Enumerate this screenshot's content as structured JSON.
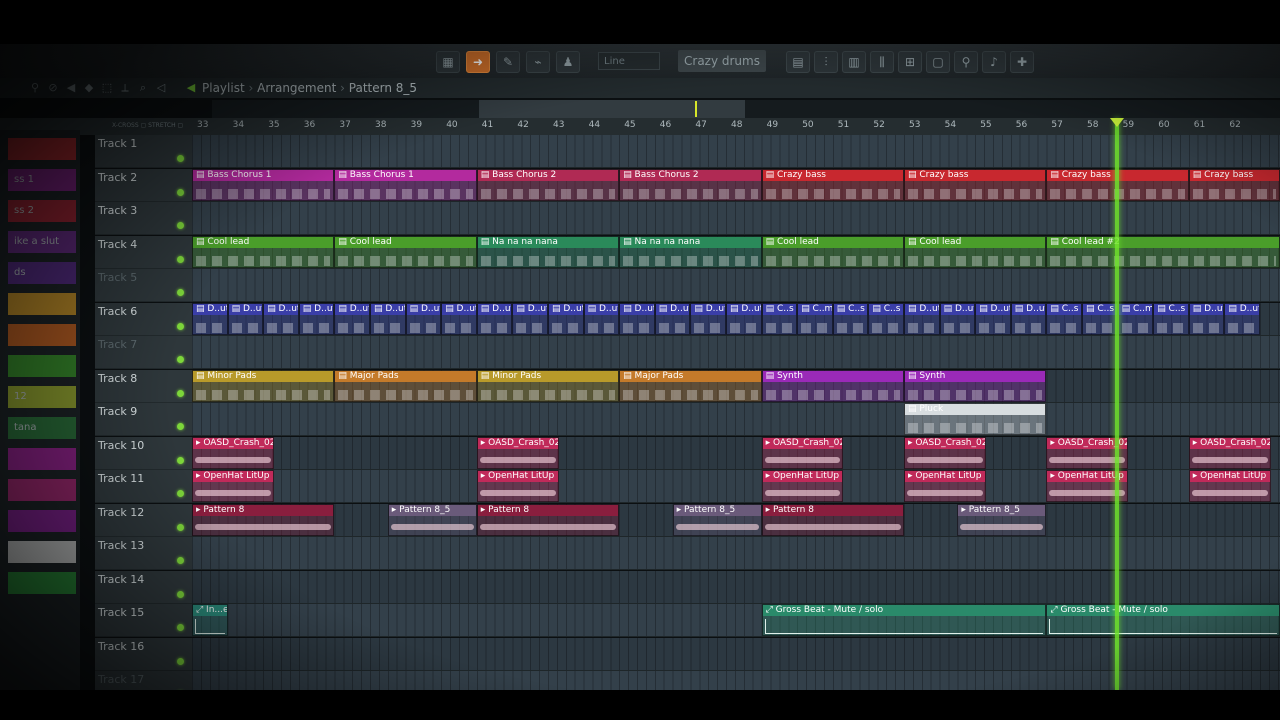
{
  "window": {
    "title_parts": [
      "Playlist",
      "Arrangement",
      "Pattern 8_5"
    ],
    "snap_value": "Line",
    "current_pattern": "Crazy drums"
  },
  "ruler": {
    "xcross_label": "X-CROSS",
    "stretch_label": "STRETCH",
    "bars": [
      "33",
      "34",
      "35",
      "36",
      "37",
      "38",
      "39",
      "40",
      "41",
      "42",
      "43",
      "44",
      "45",
      "46",
      "47",
      "48",
      "49",
      "50",
      "51",
      "52",
      "53",
      "54",
      "55",
      "56",
      "57",
      "58",
      "59",
      "60",
      "61",
      "62"
    ]
  },
  "channel_strip": [
    {
      "label": "",
      "color": "#c0282f"
    },
    {
      "label": "ss 1",
      "color": "#8a1f8e"
    },
    {
      "label": "ss 2",
      "color": "#b02233"
    },
    {
      "label": "ike a slut",
      "color": "#6d2a8e"
    },
    {
      "label": "ds",
      "color": "#5b2a8e"
    },
    {
      "label": "",
      "color": "#d49a25"
    },
    {
      "label": "",
      "color": "#d0641f"
    },
    {
      "label": "",
      "color": "#3a9a2a"
    },
    {
      "label": "12",
      "color": "#a2b52e"
    },
    {
      "label": "tana",
      "color": "#2b7a3a"
    },
    {
      "label": "",
      "color": "#a21f9a"
    },
    {
      "label": "",
      "color": "#b0267a"
    },
    {
      "label": "",
      "color": "#8e1e9e"
    },
    {
      "label": "",
      "color": "#dcdcdc"
    },
    {
      "label": "",
      "color": "#2a9a3a"
    }
  ],
  "tracks": [
    {
      "name": "Track 1",
      "dim": false,
      "clips": []
    },
    {
      "name": "Track 2",
      "dim": false,
      "clips": [
        {
          "label": "Bass Chorus 1",
          "bar": 33,
          "len": 4,
          "color": "#b32a9e",
          "kind": "notes"
        },
        {
          "label": "Bass Chorus 1",
          "bar": 37,
          "len": 4,
          "color": "#b32a9e",
          "kind": "notes"
        },
        {
          "label": "Bass Chorus 2",
          "bar": 41,
          "len": 4,
          "color": "#b02a54",
          "kind": "notes"
        },
        {
          "label": "Bass Chorus 2",
          "bar": 45,
          "len": 4,
          "color": "#b02a54",
          "kind": "notes"
        },
        {
          "label": "Crazy bass",
          "bar": 49,
          "len": 4,
          "color": "#c8282f",
          "kind": "notes"
        },
        {
          "label": "Crazy bass",
          "bar": 53,
          "len": 4,
          "color": "#c8282f",
          "kind": "notes"
        },
        {
          "label": "Crazy bass",
          "bar": 57,
          "len": 4,
          "color": "#c8282f",
          "kind": "notes"
        },
        {
          "label": "Crazy bass",
          "bar": 61,
          "len": 3,
          "color": "#c8282f",
          "kind": "notes"
        }
      ]
    },
    {
      "name": "Track 3",
      "dim": false,
      "clips": []
    },
    {
      "name": "Track 4",
      "dim": false,
      "clips": [
        {
          "label": "Cool lead",
          "bar": 33,
          "len": 4,
          "color": "#4a9e2a",
          "kind": "notes"
        },
        {
          "label": "Cool lead",
          "bar": 37,
          "len": 4,
          "color": "#4a9e2a",
          "kind": "notes"
        },
        {
          "label": "Na na na nana",
          "bar": 41,
          "len": 4,
          "color": "#2a8a5a",
          "kind": "notes"
        },
        {
          "label": "Na na na nana",
          "bar": 45,
          "len": 4,
          "color": "#2a8a5a",
          "kind": "notes"
        },
        {
          "label": "Cool lead",
          "bar": 49,
          "len": 4,
          "color": "#4a9e2a",
          "kind": "notes"
        },
        {
          "label": "Cool lead",
          "bar": 53,
          "len": 4,
          "color": "#4a9e2a",
          "kind": "notes"
        },
        {
          "label": "Cool lead #2",
          "bar": 57,
          "len": 7,
          "color": "#4a9e2a",
          "kind": "notes"
        }
      ]
    },
    {
      "name": "Track 5",
      "dim": true,
      "clips": []
    },
    {
      "name": "Track 6",
      "dim": false,
      "clips": [
        {
          "label": "D..ut",
          "bar": 33,
          "len": 1,
          "color": "#3a3ea8",
          "kind": "notes"
        },
        {
          "label": "D..ut",
          "bar": 34,
          "len": 1,
          "color": "#3a3ea8",
          "kind": "notes"
        },
        {
          "label": "D..ut",
          "bar": 35,
          "len": 1,
          "color": "#3a3ea8",
          "kind": "notes"
        },
        {
          "label": "D..ut",
          "bar": 36,
          "len": 1,
          "color": "#3a3ea8",
          "kind": "notes"
        },
        {
          "label": "D..ut",
          "bar": 37,
          "len": 1,
          "color": "#3a3ea8",
          "kind": "notes"
        },
        {
          "label": "D..ut",
          "bar": 38,
          "len": 1,
          "color": "#3a3ea8",
          "kind": "notes"
        },
        {
          "label": "D..ut",
          "bar": 39,
          "len": 1,
          "color": "#3a3ea8",
          "kind": "notes"
        },
        {
          "label": "D..ut",
          "bar": 40,
          "len": 1,
          "color": "#3a3ea8",
          "kind": "notes"
        },
        {
          "label": "D..ut",
          "bar": 41,
          "len": 1,
          "color": "#3a3ea8",
          "kind": "notes"
        },
        {
          "label": "D..ut",
          "bar": 42,
          "len": 1,
          "color": "#3a3ea8",
          "kind": "notes"
        },
        {
          "label": "D..ut",
          "bar": 43,
          "len": 1,
          "color": "#3a3ea8",
          "kind": "notes"
        },
        {
          "label": "D..ut",
          "bar": 44,
          "len": 1,
          "color": "#3a3ea8",
          "kind": "notes"
        },
        {
          "label": "D..ut",
          "bar": 45,
          "len": 1,
          "color": "#3a3ea8",
          "kind": "notes"
        },
        {
          "label": "D..ut",
          "bar": 46,
          "len": 1,
          "color": "#3a3ea8",
          "kind": "notes"
        },
        {
          "label": "D..ut",
          "bar": 47,
          "len": 1,
          "color": "#3a3ea8",
          "kind": "notes"
        },
        {
          "label": "D..ut",
          "bar": 48,
          "len": 1,
          "color": "#3a3ea8",
          "kind": "notes"
        },
        {
          "label": "C..s",
          "bar": 49,
          "len": 1,
          "color": "#3a3ea8",
          "kind": "notes"
        },
        {
          "label": "C..ms",
          "bar": 50,
          "len": 1,
          "color": "#3a3ea8",
          "kind": "notes"
        },
        {
          "label": "C..s",
          "bar": 51,
          "len": 1,
          "color": "#3a3ea8",
          "kind": "notes"
        },
        {
          "label": "C..s",
          "bar": 52,
          "len": 1,
          "color": "#3a3ea8",
          "kind": "notes"
        },
        {
          "label": "D..ut",
          "bar": 53,
          "len": 1,
          "color": "#3a3ea8",
          "kind": "notes"
        },
        {
          "label": "D..ut",
          "bar": 54,
          "len": 1,
          "color": "#3a3ea8",
          "kind": "notes"
        },
        {
          "label": "D..ut",
          "bar": 55,
          "len": 1,
          "color": "#3a3ea8",
          "kind": "notes"
        },
        {
          "label": "D..ut",
          "bar": 56,
          "len": 1,
          "color": "#3a3ea8",
          "kind": "notes"
        },
        {
          "label": "C..s",
          "bar": 57,
          "len": 1,
          "color": "#3a3ea8",
          "kind": "notes"
        },
        {
          "label": "C..s",
          "bar": 58,
          "len": 1,
          "color": "#3a3ea8",
          "kind": "notes"
        },
        {
          "label": "C..ms",
          "bar": 59,
          "len": 1,
          "color": "#3a3ea8",
          "kind": "notes"
        },
        {
          "label": "C..s",
          "bar": 60,
          "len": 1,
          "color": "#3a3ea8",
          "kind": "notes"
        },
        {
          "label": "D..ut",
          "bar": 61,
          "len": 1,
          "color": "#3a3ea8",
          "kind": "notes"
        },
        {
          "label": "D..ut",
          "bar": 62,
          "len": 1,
          "color": "#3a3ea8",
          "kind": "notes"
        }
      ]
    },
    {
      "name": "Track 7",
      "dim": true,
      "clips": []
    },
    {
      "name": "Track 8",
      "dim": false,
      "clips": [
        {
          "label": "Minor Pads",
          "bar": 33,
          "len": 4,
          "color": "#b89a2a",
          "kind": "notes"
        },
        {
          "label": "Major Pads",
          "bar": 37,
          "len": 4,
          "color": "#c47a2a",
          "kind": "notes"
        },
        {
          "label": "Minor Pads",
          "bar": 41,
          "len": 4,
          "color": "#b89a2a",
          "kind": "notes"
        },
        {
          "label": "Major Pads",
          "bar": 45,
          "len": 4,
          "color": "#c47a2a",
          "kind": "notes"
        },
        {
          "label": "Synth",
          "bar": 49,
          "len": 4,
          "color": "#9a2ab8",
          "kind": "notes"
        },
        {
          "label": "Synth",
          "bar": 53,
          "len": 4,
          "color": "#9a2ab8",
          "kind": "notes"
        }
      ]
    },
    {
      "name": "Track 9",
      "dim": false,
      "clips": [
        {
          "label": "Pluck",
          "bar": 53,
          "len": 4,
          "color": "#d8dde0",
          "kind": "notes"
        }
      ]
    },
    {
      "name": "Track 10",
      "dim": false,
      "clips": [
        {
          "label": "OASD_Crash_02",
          "bar": 33,
          "len": 2.3,
          "color": "#c02a5a",
          "kind": "wave"
        },
        {
          "label": "OASD_Crash_02",
          "bar": 41,
          "len": 2.3,
          "color": "#c02a5a",
          "kind": "wave"
        },
        {
          "label": "OASD_Crash_02",
          "bar": 49,
          "len": 2.3,
          "color": "#c02a5a",
          "kind": "wave"
        },
        {
          "label": "OASD_Crash_02",
          "bar": 53,
          "len": 2.3,
          "color": "#c02a5a",
          "kind": "wave"
        },
        {
          "label": "OASD_Crash_02",
          "bar": 57,
          "len": 2.3,
          "color": "#c02a5a",
          "kind": "wave"
        },
        {
          "label": "OASD_Crash_02",
          "bar": 61,
          "len": 2.3,
          "color": "#c02a5a",
          "kind": "wave"
        }
      ]
    },
    {
      "name": "Track 11",
      "dim": false,
      "clips": [
        {
          "label": "OpenHat LitUp 1",
          "bar": 33,
          "len": 2.3,
          "color": "#c02a5a",
          "kind": "wave"
        },
        {
          "label": "OpenHat LitUp 1",
          "bar": 41,
          "len": 2.3,
          "color": "#c02a5a",
          "kind": "wave"
        },
        {
          "label": "OpenHat LitUp 1",
          "bar": 49,
          "len": 2.3,
          "color": "#c02a5a",
          "kind": "wave"
        },
        {
          "label": "OpenHat LitUp 1",
          "bar": 53,
          "len": 2.3,
          "color": "#c02a5a",
          "kind": "wave"
        },
        {
          "label": "OpenHat LitUp 1",
          "bar": 57,
          "len": 2.3,
          "color": "#c02a5a",
          "kind": "wave"
        },
        {
          "label": "OpenHat LitUp 1",
          "bar": 61,
          "len": 2.3,
          "color": "#c02a5a",
          "kind": "wave"
        }
      ]
    },
    {
      "name": "Track 12",
      "dim": false,
      "clips": [
        {
          "label": "Pattern 8",
          "bar": 33,
          "len": 4,
          "color": "#8a1e3e",
          "kind": "wave"
        },
        {
          "label": "Pattern 8_5",
          "bar": 38.5,
          "len": 2.5,
          "color": "#6a5a7a",
          "kind": "wave"
        },
        {
          "label": "Pattern 8",
          "bar": 41,
          "len": 4,
          "color": "#8a1e3e",
          "kind": "wave"
        },
        {
          "label": "Pattern 8_5",
          "bar": 46.5,
          "len": 2.5,
          "color": "#6a5a7a",
          "kind": "wave"
        },
        {
          "label": "Pattern 8",
          "bar": 49,
          "len": 4,
          "color": "#8a1e3e",
          "kind": "wave"
        },
        {
          "label": "Pattern 8_5",
          "bar": 54.5,
          "len": 2.5,
          "color": "#6a5a7a",
          "kind": "wave"
        }
      ]
    },
    {
      "name": "Track 13",
      "dim": false,
      "clips": []
    },
    {
      "name": "Track 14",
      "dim": false,
      "clips": []
    },
    {
      "name": "Track 15",
      "dim": false,
      "clips": [
        {
          "label": "In...e",
          "bar": 33,
          "len": 1,
          "color": "#2a8a7a",
          "kind": "auto"
        },
        {
          "label": "Gross Beat - Mute / solo",
          "bar": 49,
          "len": 8,
          "color": "#2a8a6a",
          "kind": "auto"
        },
        {
          "label": "Gross Beat - Mute / solo",
          "bar": 57,
          "len": 7,
          "color": "#2a8a6a",
          "kind": "auto"
        }
      ]
    },
    {
      "name": "Track 16",
      "dim": false,
      "clips": []
    },
    {
      "name": "Track 17",
      "dim": true,
      "clips": []
    }
  ],
  "playhead_bar": 59,
  "accent_color": "#71e62c"
}
